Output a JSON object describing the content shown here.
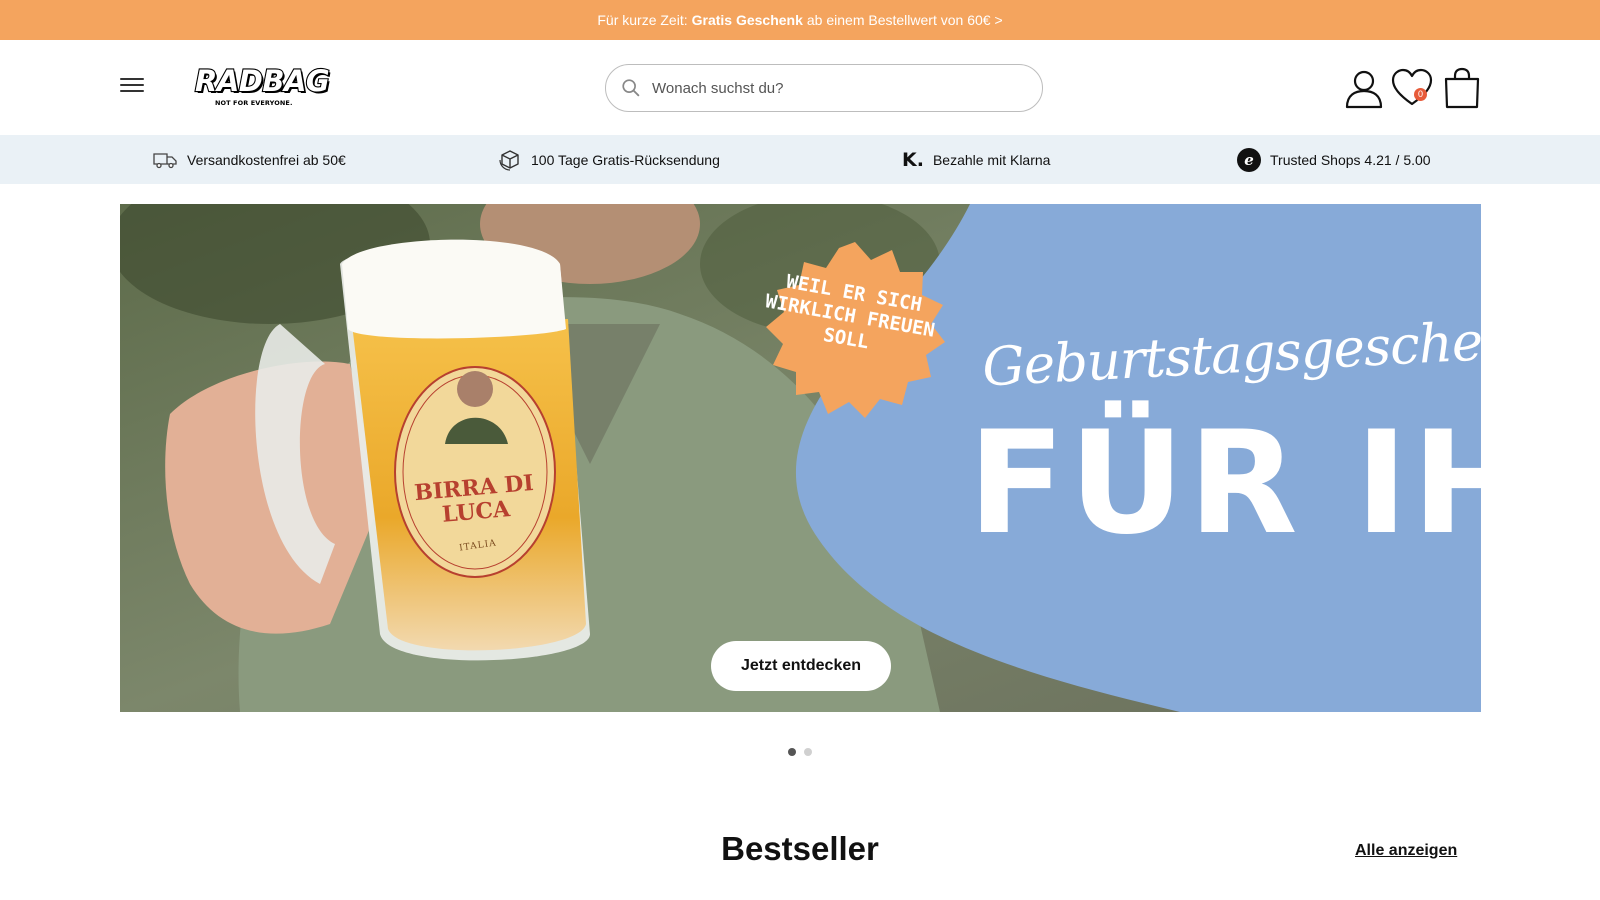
{
  "promo": {
    "prefix": "Für kurze Zeit:",
    "highlight": "Gratis Geschenk",
    "suffix": "ab einem Bestellwert von 60€ >"
  },
  "header": {
    "logo_text": "RADBAG",
    "logo_tagline": "NOT FOR EVERYONE.",
    "search_placeholder": "Wonach suchst du?",
    "wishlist_count": "0"
  },
  "usp": [
    {
      "icon": "truck-icon",
      "label": "Versandkostenfrei ab 50€"
    },
    {
      "icon": "return-box-icon",
      "label": "100 Tage Gratis-Rücksendung"
    },
    {
      "icon": "klarna-icon",
      "glyph": "K.",
      "label": "Bezahle mit Klarna"
    },
    {
      "icon": "trusted-shops-icon",
      "glyph": "e",
      "label": "Trusted Shops 4.21 / 5.00"
    }
  ],
  "hero": {
    "sticker": "WEIL ER SICH WIRKLICH FREUEN SOLL",
    "script_title": "Geburtstagsgeschenke",
    "title": "FÜR IHN",
    "mug_label": "BIRRA DI LUCA",
    "mug_sub": "ITALIA",
    "cta": "Jetzt entdecken",
    "colors": {
      "panel": "#87aad8",
      "sticker": "#f4a45e"
    }
  },
  "carousel": {
    "slides": 2,
    "active": 1
  },
  "bestseller": {
    "title": "Bestseller",
    "link": "Alle anzeigen"
  },
  "colors": {
    "promo": "#f4a45e",
    "usp_bg": "#eaf1f6",
    "badge": "#e75b3a"
  }
}
